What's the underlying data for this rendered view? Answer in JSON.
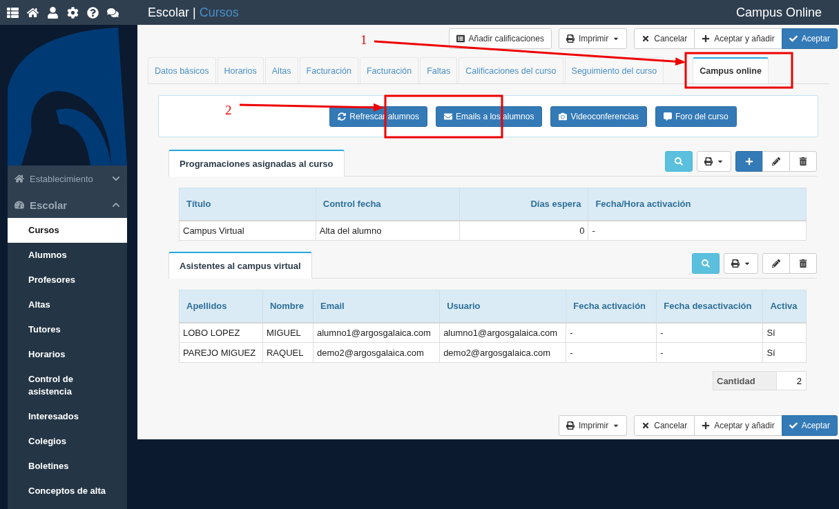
{
  "top_bar": {
    "section": "Escolar",
    "separator": "|",
    "page": "Cursos",
    "app_name": "Campus Online"
  },
  "sidebar": {
    "groups": [
      {
        "label": "Establecimiento",
        "expanded": false
      },
      {
        "label": "Escolar",
        "expanded": true,
        "children": [
          {
            "label": "Cursos",
            "selected": true
          },
          {
            "label": "Alumnos",
            "selected": false
          },
          {
            "label": "Profesores",
            "selected": false
          },
          {
            "label": "Altas",
            "selected": false
          },
          {
            "label": "Tutores",
            "selected": false
          },
          {
            "label": "Horarios",
            "selected": false
          },
          {
            "label": "Control de asistencia",
            "selected": false
          },
          {
            "label": "Interesados",
            "selected": false
          },
          {
            "label": "Colegios",
            "selected": false
          },
          {
            "label": "Boletines",
            "selected": false
          },
          {
            "label": "Conceptos de alta",
            "selected": false
          }
        ]
      }
    ]
  },
  "toolbar_top": [
    {
      "buttons": [
        {
          "label": "Añadir calificaciones",
          "kind": "grades"
        }
      ]
    },
    {
      "buttons": [
        {
          "label": "Imprimir",
          "kind": "print"
        }
      ]
    },
    {
      "buttons": [
        {
          "label": "Cancelar",
          "kind": "cancel"
        },
        {
          "label": "Aceptar y añadir",
          "kind": "add"
        },
        {
          "label": "Aceptar",
          "kind": "accept"
        }
      ]
    }
  ],
  "tabs": [
    {
      "label": "Datos básicos",
      "selected": false
    },
    {
      "label": "Horarios",
      "selected": false
    },
    {
      "label": "Altas",
      "selected": false
    },
    {
      "label": "Facturación",
      "selected": false
    },
    {
      "label": "Facturación",
      "selected": false
    },
    {
      "label": "Faltas",
      "selected": false
    },
    {
      "label": "Calificaciones del curso",
      "selected": false
    },
    {
      "label": "Seguimiento del curso",
      "selected": false
    },
    {
      "label": "Campus online",
      "selected": true
    }
  ],
  "campus_actions": [
    {
      "label": "Refrescar alumnos",
      "kind": "refresh"
    },
    {
      "label": "Emails a los alumnos",
      "kind": "email"
    },
    {
      "label": "Videoconferencias",
      "kind": "video"
    },
    {
      "label": "Foro del curso",
      "kind": "forum"
    }
  ],
  "sections": [
    {
      "title": "Programaciones asignadas al curso",
      "tools": [
        {
          "kind": "search"
        },
        {
          "kind": "print"
        },
        {
          "kind": "new"
        },
        {
          "kind": "edit"
        },
        {
          "kind": "delete"
        }
      ],
      "columns": [
        {
          "label": "Título",
          "kind": "text"
        },
        {
          "label": "Control fecha",
          "kind": "text"
        },
        {
          "label": "Días espera",
          "kind": "number"
        },
        {
          "label": "Fecha/Hora activación",
          "kind": "text"
        }
      ],
      "rows": [
        [
          "Campus Virtual",
          "Alta del alumno",
          "0",
          "-"
        ]
      ]
    },
    {
      "title": "Asistentes al campus virtual",
      "tools": [
        {
          "kind": "search"
        },
        {
          "kind": "print"
        },
        {
          "kind": "edit"
        },
        {
          "kind": "delete"
        }
      ],
      "columns": [
        {
          "label": "Apellidos",
          "kind": "text"
        },
        {
          "label": "Nombre",
          "kind": "text"
        },
        {
          "label": "Email",
          "kind": "text"
        },
        {
          "label": "Usuario",
          "kind": "text"
        },
        {
          "label": "Fecha activación",
          "kind": "text"
        },
        {
          "label": "Fecha desactivación",
          "kind": "text"
        },
        {
          "label": "Activa",
          "kind": "text"
        }
      ],
      "rows": [
        [
          "LOBO LOPEZ",
          "MIGUEL",
          "alumno1@argosgalaica.com",
          "alumno1@argosgalaica.com",
          "-",
          "-",
          "Sí"
        ],
        [
          "PAREJO MIGUEZ",
          "RAQUEL",
          "demo2@argosgalaica.com",
          "demo2@argosgalaica.com",
          "-",
          "-",
          "Sí"
        ]
      ],
      "total": {
        "label": "Cantidad",
        "value": "2"
      }
    }
  ],
  "toolbar_bottom": [
    {
      "buttons": [
        {
          "label": "Imprimir",
          "kind": "print"
        }
      ]
    },
    {
      "buttons": [
        {
          "label": "Cancelar",
          "kind": "cancel"
        },
        {
          "label": "Aceptar y añadir",
          "kind": "add"
        },
        {
          "label": "Aceptar",
          "kind": "accept"
        }
      ]
    }
  ],
  "annotations": [
    {
      "number": "1"
    },
    {
      "number": "2"
    }
  ]
}
